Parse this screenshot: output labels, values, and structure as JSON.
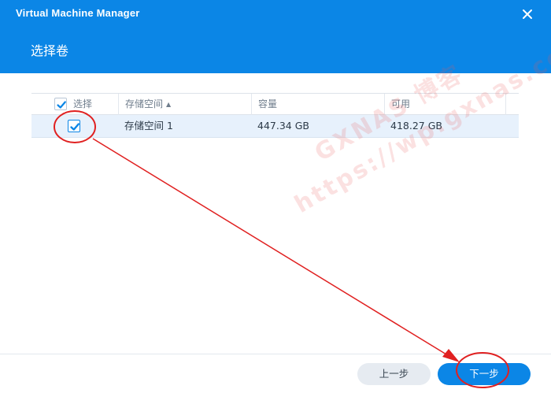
{
  "window": {
    "app_title": "Virtual Machine Manager",
    "page_title": "选择卷"
  },
  "table": {
    "columns": [
      "选择",
      "存储空间",
      "容量",
      "可用"
    ],
    "sort_indicator": "▲",
    "rows": [
      {
        "selected": true,
        "name": "存储空间 1",
        "capacity": "447.34 GB",
        "available": "418.27 GB"
      }
    ]
  },
  "buttons": {
    "prev": "上一步",
    "next": "下一步"
  },
  "watermark": {
    "line1": "GXNAS 博客",
    "line2": "https://wp.gxnas.com"
  },
  "colors": {
    "header_bg": "#0b86e6",
    "selected_row_bg": "#e7f1fc",
    "annotation": "#e02020"
  },
  "icons": {
    "close": "close-icon",
    "check": "check-icon"
  }
}
